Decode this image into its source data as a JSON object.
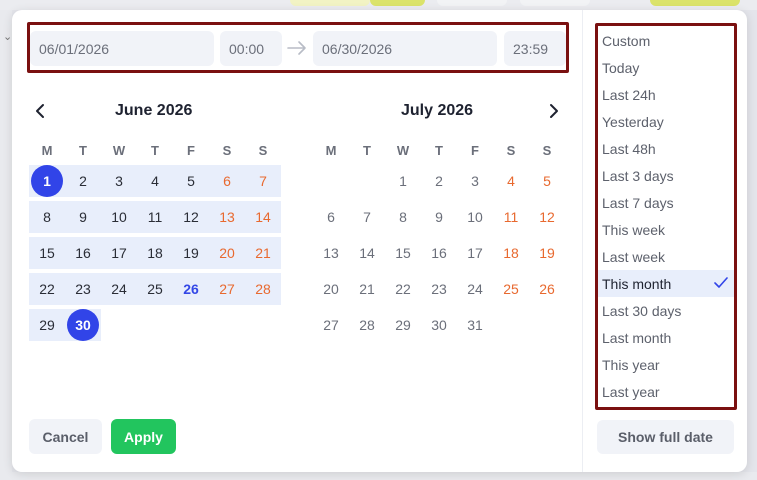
{
  "colors": {
    "accent": "#3144e8",
    "weekend": "#e8692f",
    "range": "#e8eefb",
    "apply": "#22c55e",
    "highlight_border": "#7a1010"
  },
  "range": {
    "start_date": "06/01/2026",
    "start_time": "00:00",
    "end_date": "06/30/2026",
    "end_time": "23:59"
  },
  "weekdays": [
    "M",
    "T",
    "W",
    "T",
    "F",
    "S",
    "S"
  ],
  "june": {
    "title": "June 2026",
    "weeks": [
      [
        "1",
        "2",
        "3",
        "4",
        "5",
        "6",
        "7"
      ],
      [
        "8",
        "9",
        "10",
        "11",
        "12",
        "13",
        "14"
      ],
      [
        "15",
        "16",
        "17",
        "18",
        "19",
        "20",
        "21"
      ],
      [
        "22",
        "23",
        "24",
        "25",
        "26",
        "27",
        "28"
      ],
      [
        "29",
        "30",
        "",
        "",
        "",
        "",
        ""
      ]
    ]
  },
  "july": {
    "title": "July 2026",
    "weeks": [
      [
        "",
        "",
        "1",
        "2",
        "3",
        "4",
        "5"
      ],
      [
        "6",
        "7",
        "8",
        "9",
        "10",
        "11",
        "12"
      ],
      [
        "13",
        "14",
        "15",
        "16",
        "17",
        "18",
        "19"
      ],
      [
        "20",
        "21",
        "22",
        "23",
        "24",
        "25",
        "26"
      ],
      [
        "27",
        "28",
        "29",
        "30",
        "31",
        "",
        ""
      ]
    ]
  },
  "buttons": {
    "cancel": "Cancel",
    "apply": "Apply",
    "show_full_date": "Show full date"
  },
  "presets": {
    "items": [
      "Custom",
      "Today",
      "Last 24h",
      "Yesterday",
      "Last 48h",
      "Last 3 days",
      "Last 7 days",
      "This week",
      "Last week",
      "This month",
      "Last 30 days",
      "Last month",
      "This year",
      "Last year"
    ],
    "selected": "This month"
  },
  "icons": {
    "prev": "chevron-left-icon",
    "next": "chevron-right-icon",
    "arrow": "arrow-right-icon",
    "check": "check-icon"
  }
}
